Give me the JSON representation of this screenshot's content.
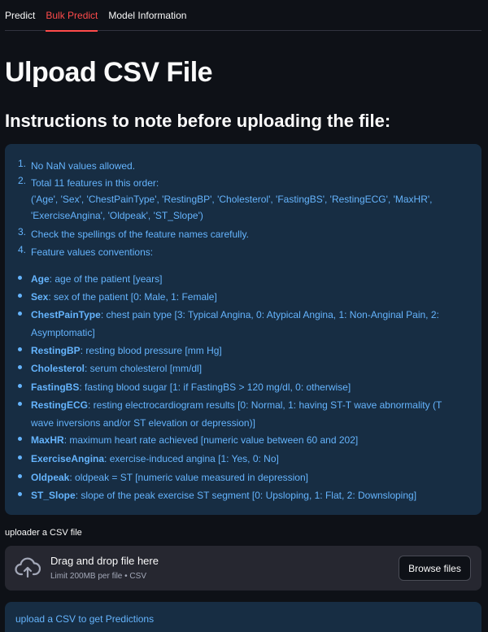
{
  "tabs": [
    {
      "label": "Predict",
      "active": false
    },
    {
      "label": "Bulk Predict",
      "active": true
    },
    {
      "label": "Model Information",
      "active": false
    }
  ],
  "page_title": "Ulpoad CSV File",
  "subtitle": "Instructions to note before uploading the file:",
  "instructions": {
    "numbered": [
      {
        "num": "1.",
        "lines": [
          "No NaN values allowed."
        ]
      },
      {
        "num": "2.",
        "lines": [
          "Total 11 features in this order:",
          "('Age', 'Sex', 'ChestPainType', 'RestingBP', 'Cholesterol', 'FastingBS', 'RestingECG', 'MaxHR',",
          "'ExerciseAngina', 'Oldpeak', 'ST_Slope')"
        ]
      },
      {
        "num": "3.",
        "lines": [
          "Check the spellings of the feature names carefully."
        ]
      },
      {
        "num": "4.",
        "lines": [
          "Feature values conventions:"
        ]
      }
    ],
    "features": [
      {
        "name": "Age",
        "desc": ": age of the patient [years]"
      },
      {
        "name": "Sex",
        "desc": ": sex of the patient [0: Male, 1: Female]"
      },
      {
        "name": "ChestPainType",
        "desc": ": chest pain type [3: Typical Angina, 0: Atypical Angina, 1: Non-Anginal Pain, 2: Asymptomatic]"
      },
      {
        "name": "RestingBP",
        "desc": ": resting blood pressure [mm Hg]"
      },
      {
        "name": "Cholesterol",
        "desc": ": serum cholesterol [mm/dl]"
      },
      {
        "name": "FastingBS",
        "desc": ": fasting blood sugar [1: if FastingBS > 120 mg/dl, 0: otherwise]"
      },
      {
        "name": "RestingECG",
        "desc": ": resting electrocardiogram results [0: Normal, 1: having ST-T wave abnormality (T wave inversions and/or ST elevation or depression)]"
      },
      {
        "name": "MaxHR",
        "desc": ": maximum heart rate achieved [numeric value between 60 and 202]"
      },
      {
        "name": "ExerciseAngina",
        "desc": ": exercise-induced angina [1: Yes, 0: No]"
      },
      {
        "name": "Oldpeak",
        "desc": ": oldpeak = ST [numeric value measured in depression]"
      },
      {
        "name": "ST_Slope",
        "desc": ": slope of the peak exercise ST segment [0: Upsloping, 1: Flat, 2: Downsloping]"
      }
    ]
  },
  "uploader": {
    "label": "uploader a CSV file",
    "drop_title": "Drag and drop file here",
    "drop_subtitle": "Limit 200MB per file • CSV",
    "browse_label": "Browse files",
    "icon": "cloud-upload-icon"
  },
  "alert": {
    "text": "upload a CSV to get Predictions"
  },
  "colors": {
    "accent": "#ff4b4b",
    "info_bg": "#172d43",
    "info_text": "#65b4fd",
    "bg": "#0e1117"
  }
}
